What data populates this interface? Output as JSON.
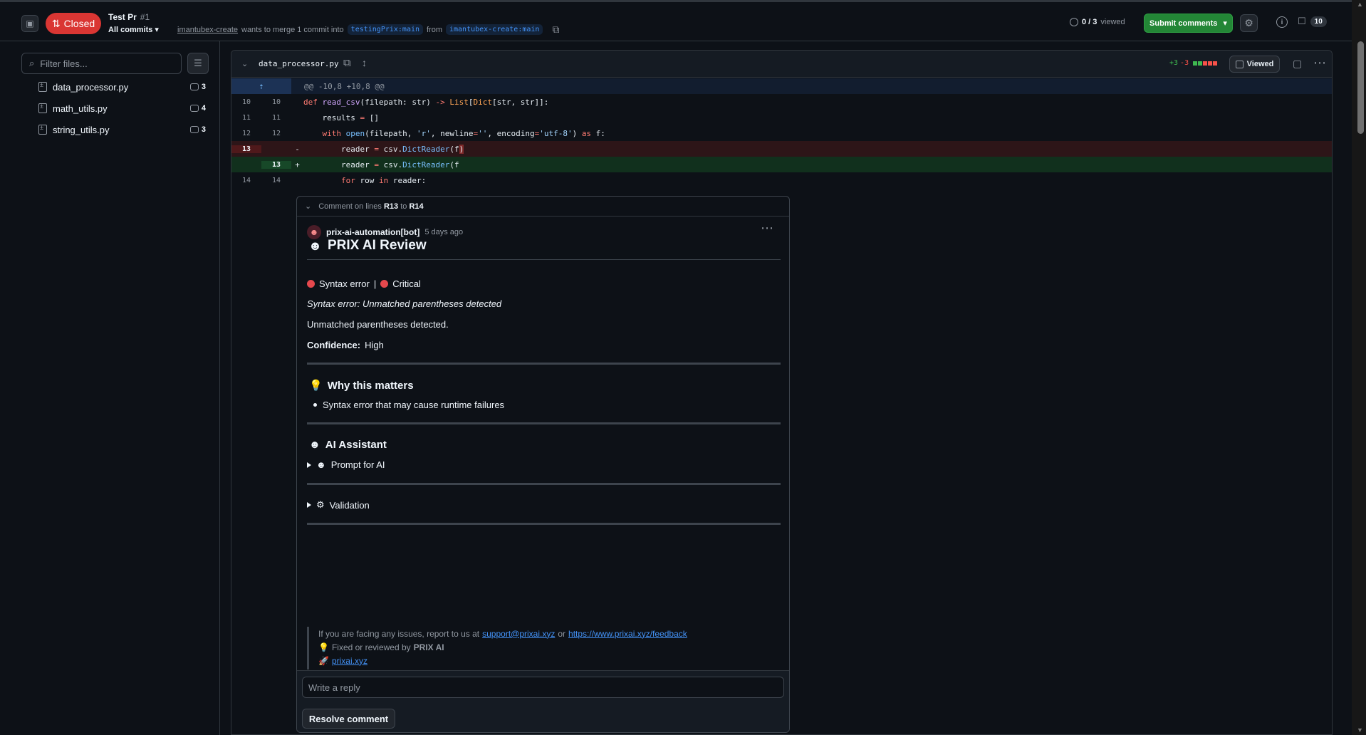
{
  "header": {
    "state": "Closed",
    "title": "Test Pr",
    "number": "#1",
    "commits_label": "All commits",
    "author": "imantubex-create",
    "merge_text": "wants to merge 1 commit into",
    "base_branch": "testingPrix:main",
    "from_text": "from",
    "head_branch": "imantubex-create:main",
    "viewed_count": "0 / 3",
    "viewed_label": "viewed",
    "submit_label": "Submit comments",
    "comments_count": "10"
  },
  "files": {
    "filter_placeholder": "Filter files...",
    "items": [
      {
        "name": "data_processor.py",
        "comments": "3"
      },
      {
        "name": "math_utils.py",
        "comments": "4"
      },
      {
        "name": "string_utils.py",
        "comments": "3"
      }
    ]
  },
  "diff": {
    "file_name": "data_processor.py",
    "additions": "+3",
    "deletions": "-3",
    "viewed_label": "Viewed",
    "hunk": "@@ -10,8 +10,8 @@",
    "lines": [
      {
        "old": "10",
        "new": "10",
        "marker": "",
        "code": "def read_csv(filepath: str) -> List[Dict[str, str]]:"
      },
      {
        "old": "11",
        "new": "11",
        "marker": "",
        "code": "    results = []"
      },
      {
        "old": "12",
        "new": "12",
        "marker": "",
        "code": "    with open(filepath, 'r', newline='', encoding='utf-8') as f:"
      },
      {
        "old": "13",
        "new": "",
        "marker": "-",
        "code": "        reader = csv.DictReader(f)"
      },
      {
        "old": "",
        "new": "13",
        "marker": "+",
        "code": "        reader = csv.DictReader(f"
      },
      {
        "old": "14",
        "new": "14",
        "marker": "",
        "code": "        for row in reader:"
      }
    ]
  },
  "comment": {
    "range_label": "Comment on lines",
    "range_start": "R13",
    "range_to": "to",
    "range_end": "R14",
    "author": "prix-ai-automation[bot]",
    "time": "5 days ago",
    "title": "PRIX AI Review",
    "type": "Syntax error",
    "severity": "Critical",
    "italic_summary": "Syntax error: Unmatched parentheses detected",
    "summary": "Unmatched parentheses detected.",
    "confidence_label": "Confidence:",
    "confidence_value": "High",
    "why_title": "Why this matters",
    "why_item": "Syntax error that may cause runtime failures",
    "assistant_title": "AI Assistant",
    "prompt_label": "Prompt for AI",
    "validation_label": "Validation",
    "issues_text": "If you are facing any issues, report to us at",
    "support_email": "support@prixai.xyz",
    "or_text": "or",
    "feedback_link": "https://www.prixai.xyz/feedback",
    "fixed_text": "Fixed or reviewed by",
    "brand": "PRIX AI",
    "site": "prixai.xyz",
    "reply_placeholder": "Write a reply",
    "resolve_label": "Resolve comment"
  },
  "icons": {
    "sidebar": "sidebar-icon",
    "pr_closed": "pull-request-closed-icon",
    "copy": "copy-icon",
    "settings": "gear-icon",
    "info": "info-icon",
    "comment": "comment-icon",
    "bot_avatar": "robot-avatar-icon",
    "bulb": "lightbulb-icon",
    "gear": "gear-icon",
    "rocket": "rocket-icon"
  },
  "colors": {
    "background": "#0d1117",
    "closed_badge": "#da3633",
    "submit_green": "#238636",
    "deletion": "#f85149",
    "addition": "#3fb950",
    "link": "#4493f8"
  }
}
